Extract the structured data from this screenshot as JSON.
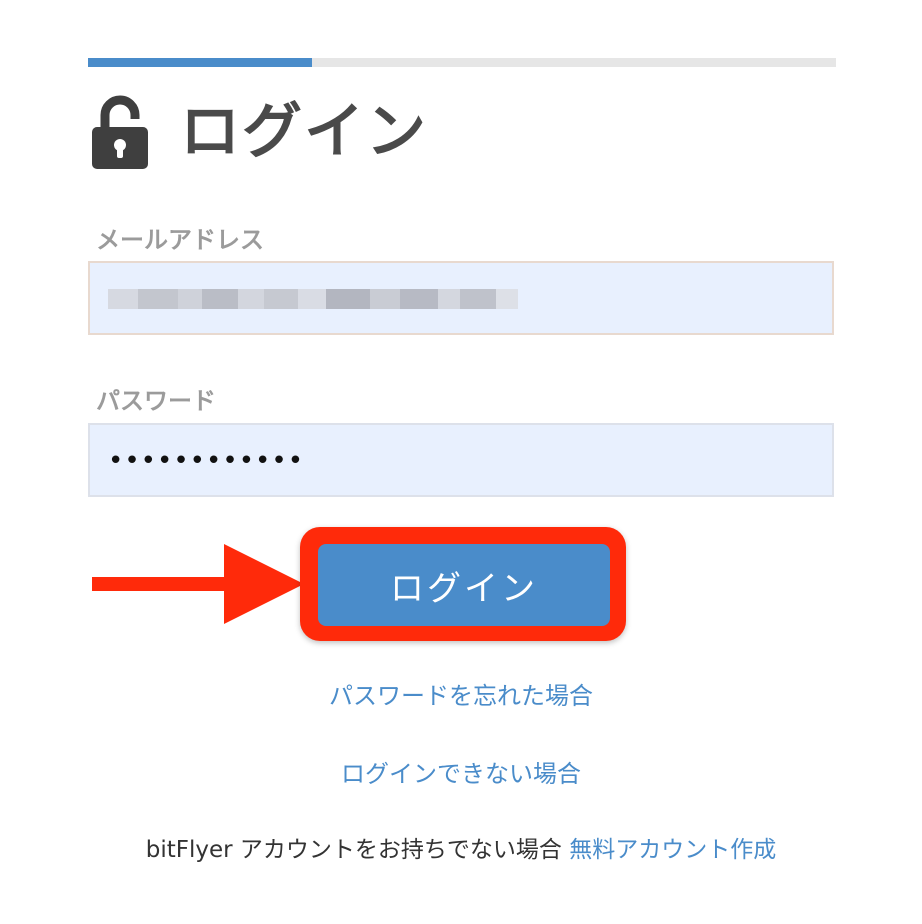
{
  "progress": {
    "fill_fraction": 0.3,
    "fill_color": "#4a8cca",
    "track_color": "#e6e6e6"
  },
  "header": {
    "title": "ログイン",
    "icon": "unlocked-padlock-icon"
  },
  "form": {
    "email": {
      "label": "メールアドレス",
      "value_state": "pixelated/obscured"
    },
    "password": {
      "label": "パスワード",
      "masked_value": "••••••••••••"
    },
    "submit_label": "ログイン"
  },
  "links": {
    "forgot_password": "パスワードを忘れた場合",
    "cannot_login": "ログインできない場合"
  },
  "signup": {
    "prompt": "bitFlyer アカウントをお持ちでない場合",
    "link": "無料アカウント作成"
  },
  "annotation": {
    "arrow_color": "#ff2a0a",
    "highlight_color": "#ff2a0a"
  },
  "colors": {
    "accent": "#4a8cca",
    "input_bg": "#e8f0fe",
    "title": "#4a4a4a",
    "label": "#9b9b9b"
  }
}
